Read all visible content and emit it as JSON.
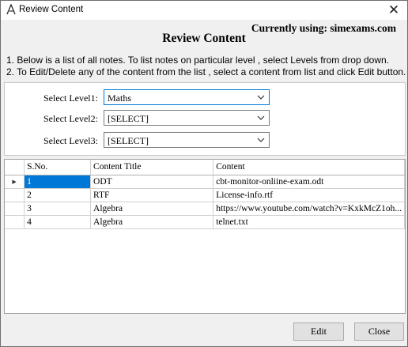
{
  "window": {
    "title": "Review Content",
    "app_icon": "app-logo-icon",
    "close_icon": "close-icon",
    "close_glyph": "✕"
  },
  "header": {
    "currently_using": "Currently using: simexams.com",
    "page_title": "Review Content"
  },
  "instructions": [
    "1. Below is a list of all notes. To list notes on particular level , select Levels from drop down.",
    "2. To Edit/Delete any of the content from the list , select a content from list and click Edit button."
  ],
  "filters": {
    "level1": {
      "label": "Select Level1:",
      "value": "Maths"
    },
    "level2": {
      "label": "Select Level2:",
      "value": "[SELECT]"
    },
    "level3": {
      "label": "Select Level3:",
      "value": "[SELECT]"
    }
  },
  "grid": {
    "columns": [
      "S.No.",
      "Content Title",
      "Content"
    ],
    "current_row_marker": "▶",
    "rows": [
      {
        "sno": "1",
        "title": "ODT",
        "content": "cbt-monitor-onliine-exam.odt",
        "selected": true
      },
      {
        "sno": "2",
        "title": "RTF",
        "content": "License-info.rtf",
        "selected": false
      },
      {
        "sno": "3",
        "title": "Algebra",
        "content": "https://www.youtube.com/watch?v=KxkMcZ1oh...",
        "selected": false
      },
      {
        "sno": "4",
        "title": "Algebra",
        "content": "telnet.txt",
        "selected": false
      }
    ]
  },
  "buttons": {
    "edit": "Edit",
    "close": "Close"
  },
  "colors": {
    "selection": "#0078d7",
    "focus_border": "#0078d7",
    "button_face": "#e1e1e1",
    "window_bg": "#f0f0f0"
  }
}
